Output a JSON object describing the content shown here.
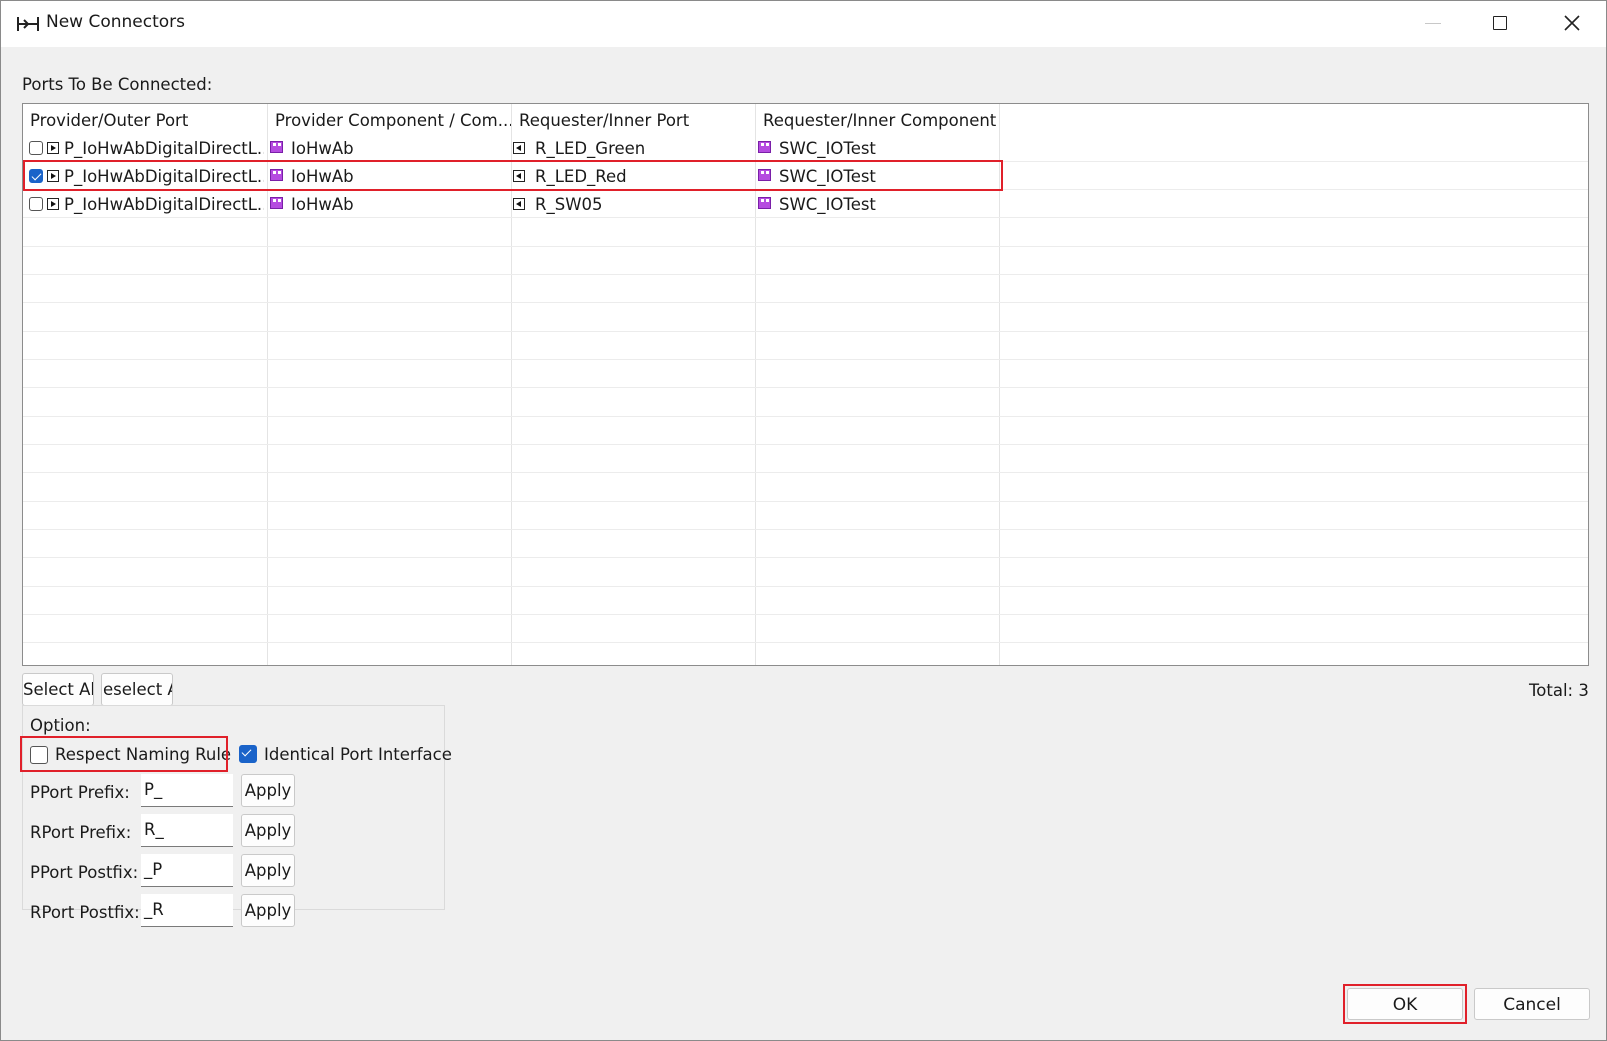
{
  "window": {
    "title": "New Connectors"
  },
  "ports_label": "Ports To Be Connected:",
  "table": {
    "columns": [
      "Provider/Outer Port",
      "Provider Component / Com...",
      "Requester/Inner Port",
      "Requester/Inner Component"
    ],
    "rows": [
      {
        "checked": false,
        "provider_port": "P_IoHwAbDigitalDirectL...",
        "provider_component": "IoHwAb",
        "requester_port": "R_LED_Green",
        "requester_component": "SWC_IOTest"
      },
      {
        "checked": true,
        "provider_port": "P_IoHwAbDigitalDirectL...",
        "provider_component": "IoHwAb",
        "requester_port": "R_LED_Red",
        "requester_component": "SWC_IOTest"
      },
      {
        "checked": false,
        "provider_port": "P_IoHwAbDigitalDirectL...",
        "provider_component": "IoHwAb",
        "requester_port": "R_SW05",
        "requester_component": "SWC_IOTest"
      }
    ]
  },
  "select_all_label": "Select Al",
  "deselect_all_label": "eselect A",
  "total_label": "Total: 3",
  "options": {
    "title": "Option:",
    "respect_naming_rule": {
      "label": "Respect Naming Rule",
      "checked": false
    },
    "identical_port_interface": {
      "label": "Identical Port Interface",
      "checked": true
    },
    "pport_prefix": {
      "label": "PPort Prefix:",
      "value": "P_",
      "apply": "Apply"
    },
    "rport_prefix": {
      "label": "RPort Prefix:",
      "value": "R_",
      "apply": "Apply"
    },
    "pport_postfix": {
      "label": "PPort Postfix:",
      "value": "_P",
      "apply": "Apply"
    },
    "rport_postfix": {
      "label": "RPort Postfix:",
      "value": "_R",
      "apply": "Apply"
    }
  },
  "ok_label": "OK",
  "cancel_label": "Cancel",
  "colors": {
    "accent": "#1a63c9",
    "highlight": "#e0202a",
    "component": "#b54be0"
  }
}
